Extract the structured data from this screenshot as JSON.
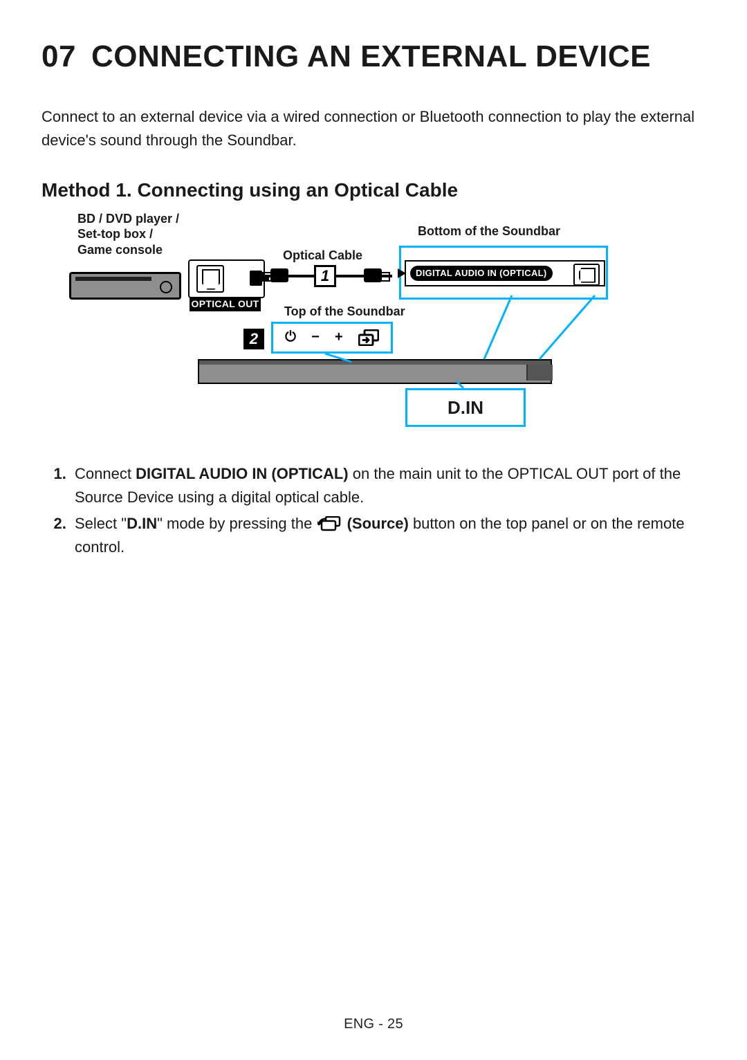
{
  "chapter": {
    "number": "07",
    "title": "CONNECTING AN EXTERNAL DEVICE"
  },
  "intro": "Connect to an external device via a wired connection or Bluetooth connection to play the external device's sound through the Soundbar.",
  "method1": {
    "title": "Method 1. Connecting using an Optical Cable"
  },
  "diagram": {
    "source_device_label_l1": "BD / DVD player /",
    "source_device_label_l2": "Set-top box /",
    "source_device_label_l3": "Game console",
    "optical_cable_label": "Optical Cable",
    "bottom_label": "Bottom of the Soundbar",
    "top_label": "Top of the Soundbar",
    "optical_out_label": "OPTICAL OUT",
    "digital_audio_label": "DIGITAL AUDIO IN (OPTICAL)",
    "marker1": "1",
    "marker2": "2",
    "din_label": "D.IN"
  },
  "steps": {
    "s1_a": "Connect ",
    "s1_b": "DIGITAL AUDIO IN (OPTICAL)",
    "s1_c": " on the main unit to the OPTICAL OUT port of the Source Device using a digital optical cable.",
    "s2_a": "Select \"",
    "s2_b": "D.IN",
    "s2_c": "\" mode by pressing the ",
    "s2_d": " (Source)",
    "s2_e": " button on the top panel or on the remote control."
  },
  "footer": "ENG - 25",
  "icons": {
    "power": "⏻",
    "minus": "−",
    "plus": "+"
  }
}
